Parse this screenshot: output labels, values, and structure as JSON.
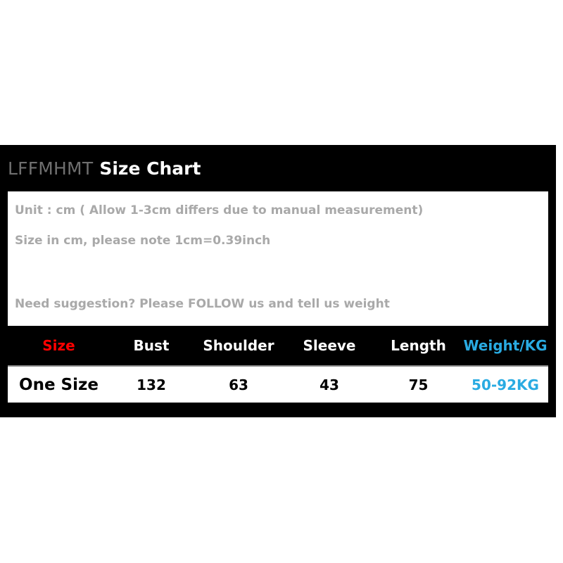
{
  "panel": {
    "background_color": "#000000",
    "title": {
      "brand": "LFFMHMT",
      "label": "Size Chart"
    },
    "info": {
      "line1": "Unit : cm ( Allow 1-3cm differs due to manual measurement)",
      "line2": "Size in cm, please note 1cm=0.39inch",
      "line3": "Need suggestion? Please FOLLOW us and tell us weight"
    }
  },
  "colors": {
    "accent_red": "#ff0000",
    "accent_cyan": "#29abe2",
    "brand_gray": "#6f6f6f",
    "info_gray": "#a9a9a9",
    "panel_black": "#000000",
    "row_white": "#ffffff"
  },
  "chart_data": {
    "type": "table",
    "title": "LFFMHMT Size Chart",
    "columns": [
      "Size",
      "Bust",
      "Shoulder",
      "Sleeve",
      "Length",
      "Weight/KG"
    ],
    "rows": [
      {
        "size": "One Size",
        "bust": "132",
        "shoulder": "63",
        "sleeve": "43",
        "length": "75",
        "weight": "50-92KG"
      }
    ],
    "unit": "cm",
    "notes": [
      "Unit : cm ( Allow 1-3cm differs due to manual measurement)",
      "Size in cm, please note 1cm=0.39inch",
      "Need suggestion? Please FOLLOW us and tell us weight"
    ]
  }
}
